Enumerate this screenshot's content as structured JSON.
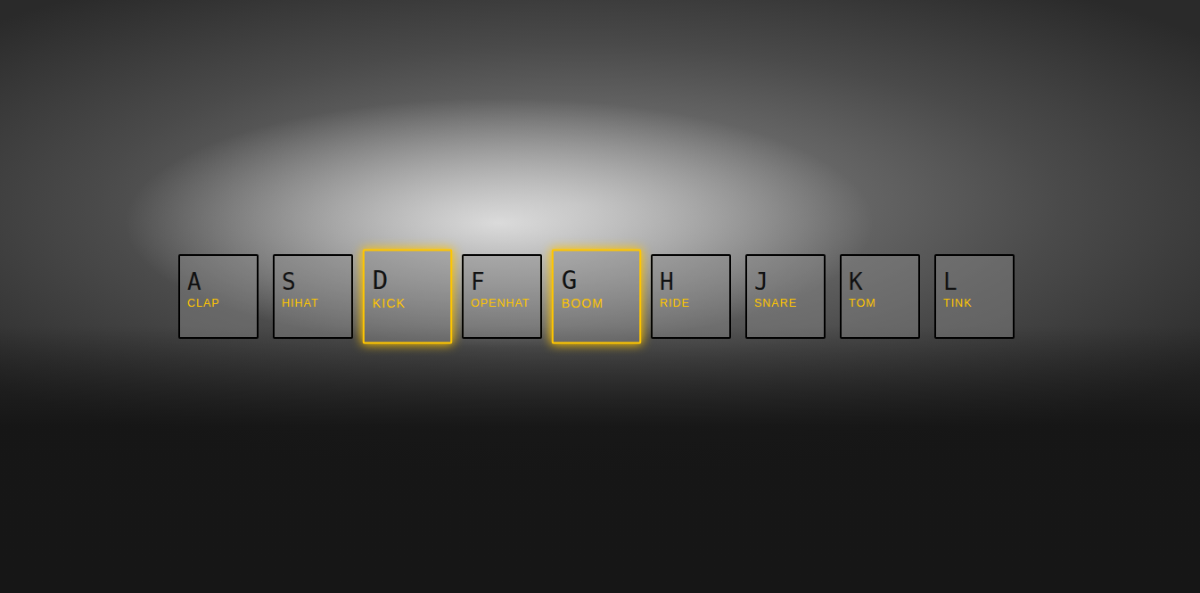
{
  "keys": [
    {
      "letter": "A",
      "sound": "CLAP",
      "selected": false
    },
    {
      "letter": "S",
      "sound": "HIHAT",
      "selected": false
    },
    {
      "letter": "D",
      "sound": "KICK",
      "selected": true
    },
    {
      "letter": "F",
      "sound": "OPENHAT",
      "selected": false
    },
    {
      "letter": "G",
      "sound": "BOOM",
      "selected": true
    },
    {
      "letter": "H",
      "sound": "RIDE",
      "selected": false
    },
    {
      "letter": "J",
      "sound": "SNARE",
      "selected": false
    },
    {
      "letter": "K",
      "sound": "TOM",
      "selected": false
    },
    {
      "letter": "L",
      "sound": "TINK",
      "selected": false
    }
  ]
}
